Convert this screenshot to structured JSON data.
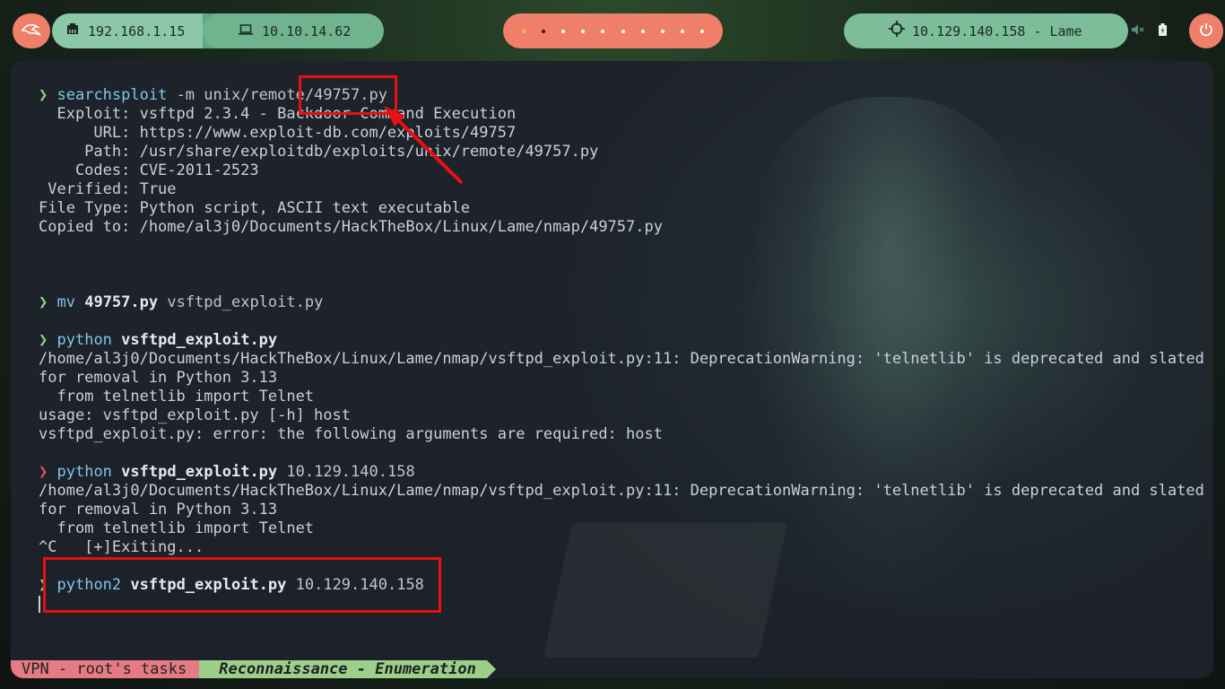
{
  "topbar": {
    "menu_icon": "kali-dragon-icon",
    "host_ip": "192.168.1.15",
    "host_icon": "ethernet-icon",
    "vpn_ip": "10.10.14.62",
    "vpn_icon": "laptop-icon",
    "target_label": "10.129.140.158 - Lame",
    "target_icon": "crosshair-icon",
    "power_icon": "power-icon",
    "volume_icon": "volume-muted-icon",
    "battery_icon": "battery-icon"
  },
  "terminal": {
    "lines": [
      {
        "type": "cmd",
        "prompt": "❯",
        "cmd": "searchsploit",
        "rest": " -m unix/remote/49757.py"
      },
      {
        "type": "out",
        "text": "  Exploit: vsftpd 2.3.4 - Backdoor Command Execution"
      },
      {
        "type": "out",
        "text": "      URL: https://www.exploit-db.com/exploits/49757"
      },
      {
        "type": "out",
        "text": "     Path: /usr/share/exploitdb/exploits/unix/remote/49757.py"
      },
      {
        "type": "out",
        "text": "    Codes: CVE-2011-2523"
      },
      {
        "type": "out",
        "text": " Verified: True"
      },
      {
        "type": "out",
        "text": "File Type: Python script, ASCII text executable"
      },
      {
        "type": "out",
        "text": "Copied to: /home/al3j0/Documents/HackTheBox/Linux/Lame/nmap/49757.py"
      },
      {
        "type": "blank"
      },
      {
        "type": "blank"
      },
      {
        "type": "blank"
      },
      {
        "type": "cmd2",
        "prompt": "❯",
        "cmd": "mv",
        "b": " 49757.py",
        "rest": " vsftpd_exploit.py"
      },
      {
        "type": "blank"
      },
      {
        "type": "cmd2",
        "prompt": "❯",
        "cmd": "python",
        "b": " vsftpd_exploit.py",
        "rest": ""
      },
      {
        "type": "out",
        "text": "/home/al3j0/Documents/HackTheBox/Linux/Lame/nmap/vsftpd_exploit.py:11: DeprecationWarning: 'telnetlib' is deprecated and slated"
      },
      {
        "type": "out",
        "text": "for removal in Python 3.13"
      },
      {
        "type": "out",
        "text": "  from telnetlib import Telnet"
      },
      {
        "type": "out",
        "text": "usage: vsftpd_exploit.py [-h] host"
      },
      {
        "type": "out",
        "text": "vsftpd_exploit.py: error: the following arguments are required: host"
      },
      {
        "type": "blank"
      },
      {
        "type": "cmd2err",
        "prompt": "❯",
        "cmd": "python",
        "b": " vsftpd_exploit.py",
        "rest": " 10.129.140.158"
      },
      {
        "type": "out",
        "text": "/home/al3j0/Documents/HackTheBox/Linux/Lame/nmap/vsftpd_exploit.py:11: DeprecationWarning: 'telnetlib' is deprecated and slated"
      },
      {
        "type": "out",
        "text": "for removal in Python 3.13"
      },
      {
        "type": "out",
        "text": "  from telnetlib import Telnet"
      },
      {
        "type": "out",
        "text": "^C   [+]Exiting..."
      },
      {
        "type": "blank"
      },
      {
        "type": "cmd2",
        "prompt": "❯",
        "cmd": "python2",
        "b": " vsftpd_exploit.py",
        "rest": " 10.129.140.158"
      },
      {
        "type": "cursor"
      }
    ]
  },
  "statusbar": {
    "session": "VPN - root's tasks",
    "window": "Reconnaissance - Enumeration"
  },
  "colors": {
    "accent_coral": "#f07f6a",
    "accent_green": "#7dbd9a",
    "annotation_red": "#e81010"
  }
}
